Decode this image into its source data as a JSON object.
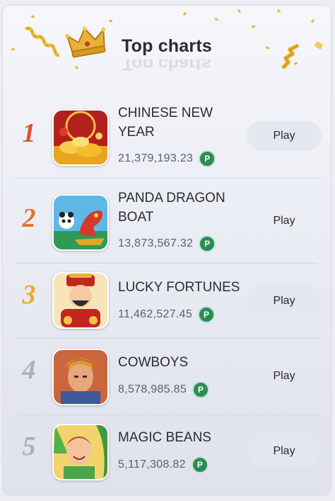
{
  "header": {
    "title": "Top charts"
  },
  "games": [
    {
      "rank": "1",
      "name": "CHINESE NEW YEAR",
      "amount": "21,379,193.23",
      "coin": "P",
      "play_label": "Play",
      "rank_color": "#e0512f"
    },
    {
      "rank": "2",
      "name": "PANDA DRAGON BOAT",
      "amount": "13,873,567.32",
      "coin": "P",
      "play_label": "Play",
      "rank_color": "#e8732c"
    },
    {
      "rank": "3",
      "name": "LUCKY FORTUNES",
      "amount": "11,462,527.45",
      "coin": "P",
      "play_label": "Play",
      "rank_color": "#efa830"
    },
    {
      "rank": "4",
      "name": "COWBOYS",
      "amount": "8,578,985.85",
      "coin": "P",
      "play_label": "Play",
      "rank_color": "#a9afc4"
    },
    {
      "rank": "5",
      "name": "MAGIC BEANS",
      "amount": "5,117,308.82",
      "coin": "P",
      "play_label": "Play",
      "rank_color": "#a9afc4"
    }
  ],
  "icons": {
    "crown": "crown-icon",
    "coin": "coin-icon"
  }
}
